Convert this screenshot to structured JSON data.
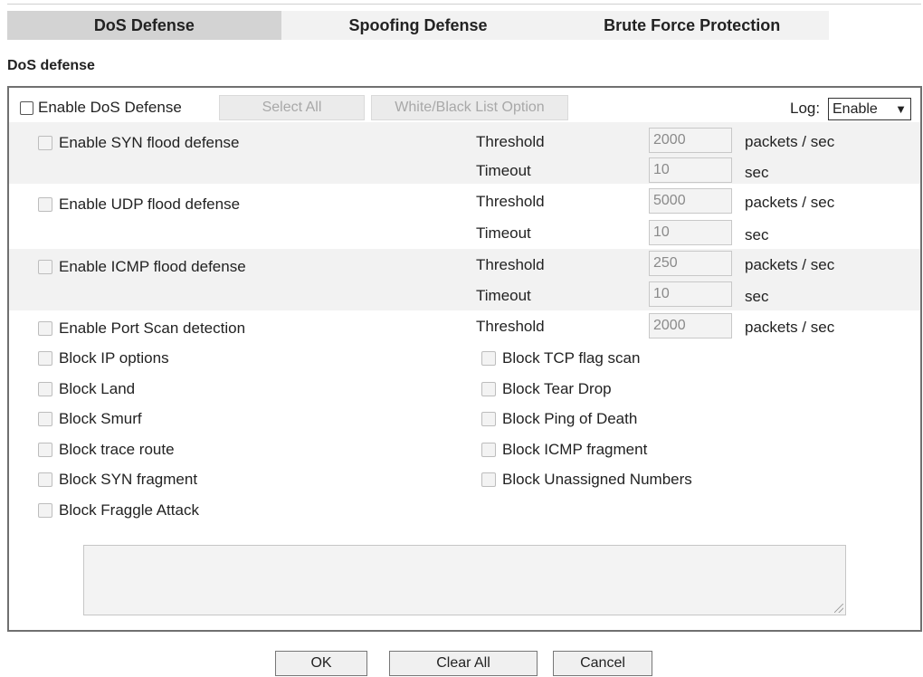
{
  "tabs": [
    "DoS Defense",
    "Spoofing Defense",
    "Brute Force Protection"
  ],
  "section_title": "DoS defense",
  "header": {
    "enable_label": "Enable DoS Defense",
    "select_all_label": "Select All",
    "wb_list_label": "White/Black List Option",
    "log_label": "Log:",
    "log_value": "Enable"
  },
  "defenses": [
    {
      "label": "Enable SYN flood defense",
      "threshold_label": "Threshold",
      "threshold": "2000",
      "threshold_unit": "packets / sec",
      "timeout_label": "Timeout",
      "timeout": "10",
      "timeout_unit": "sec"
    },
    {
      "label": "Enable UDP flood defense",
      "threshold_label": "Threshold",
      "threshold": "5000",
      "threshold_unit": "packets / sec",
      "timeout_label": "Timeout",
      "timeout": "10",
      "timeout_unit": "sec"
    },
    {
      "label": "Enable ICMP flood defense",
      "threshold_label": "Threshold",
      "threshold": "250",
      "threshold_unit": "packets / sec",
      "timeout_label": "Timeout",
      "timeout": "10",
      "timeout_unit": "sec"
    }
  ],
  "port_scan": {
    "label": "Enable Port Scan detection",
    "threshold_label": "Threshold",
    "threshold": "2000",
    "threshold_unit": "packets / sec"
  },
  "left_blocks": [
    "Block IP options",
    "Block Land",
    "Block Smurf",
    "Block trace route",
    "Block SYN fragment",
    "Block Fraggle Attack"
  ],
  "right_blocks": [
    "Block TCP flag scan",
    "Block Tear Drop",
    "Block Ping of Death",
    "Block ICMP fragment",
    "Block Unassigned Numbers"
  ],
  "buttons": {
    "ok": "OK",
    "clear_all": "Clear All",
    "cancel": "Cancel"
  }
}
